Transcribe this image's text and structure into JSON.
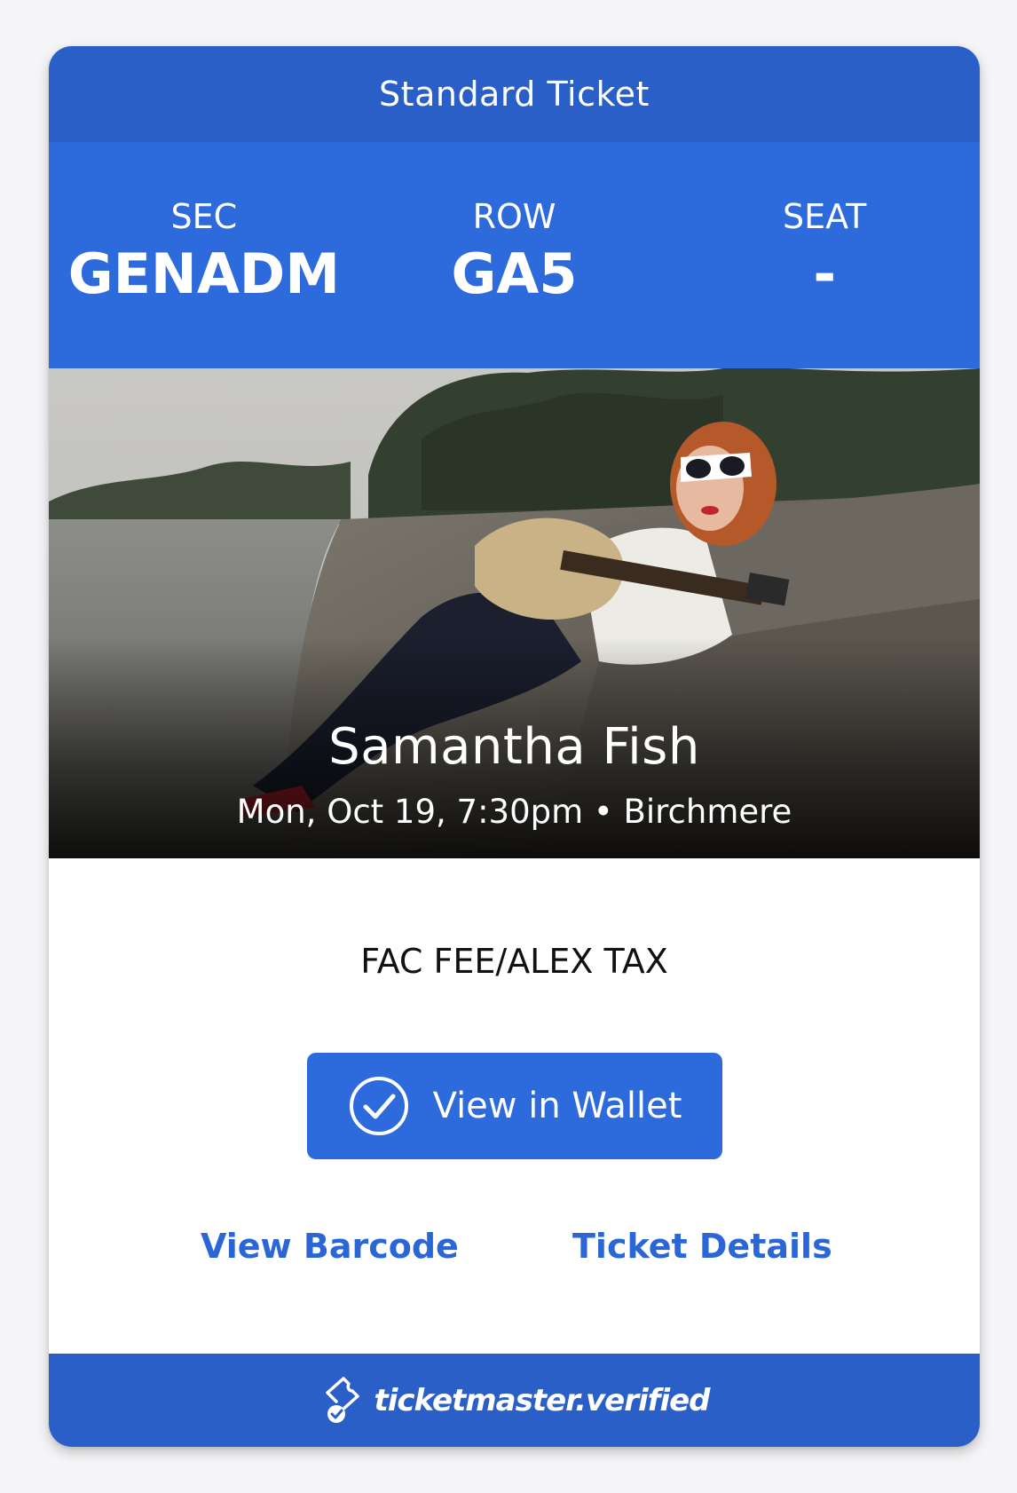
{
  "ticket": {
    "type_label": "Standard Ticket",
    "section_label": "SEC",
    "section_value": "GENADM",
    "row_label": "ROW",
    "row_value": "GA5",
    "seat_label": "SEAT",
    "seat_value": "-"
  },
  "event": {
    "name": "Samantha Fish",
    "meta": "Mon, Oct 19, 7:30pm • Birchmere"
  },
  "details": {
    "fee_note": "FAC FEE/ALEX TAX",
    "wallet_button_label": "View in Wallet",
    "view_barcode_label": "View Barcode",
    "ticket_details_label": "Ticket Details"
  },
  "footer": {
    "brand": "ticketmaster.verified"
  },
  "icons": {
    "wallet": "check-circle-icon",
    "footer": "verified-ticket-icon"
  },
  "colors": {
    "header_bar": "#2a5fc8",
    "seat_panel": "#2d6adb",
    "button": "#2d6adb",
    "link": "#2a66d6",
    "footer_bar": "#2a5fc8"
  }
}
